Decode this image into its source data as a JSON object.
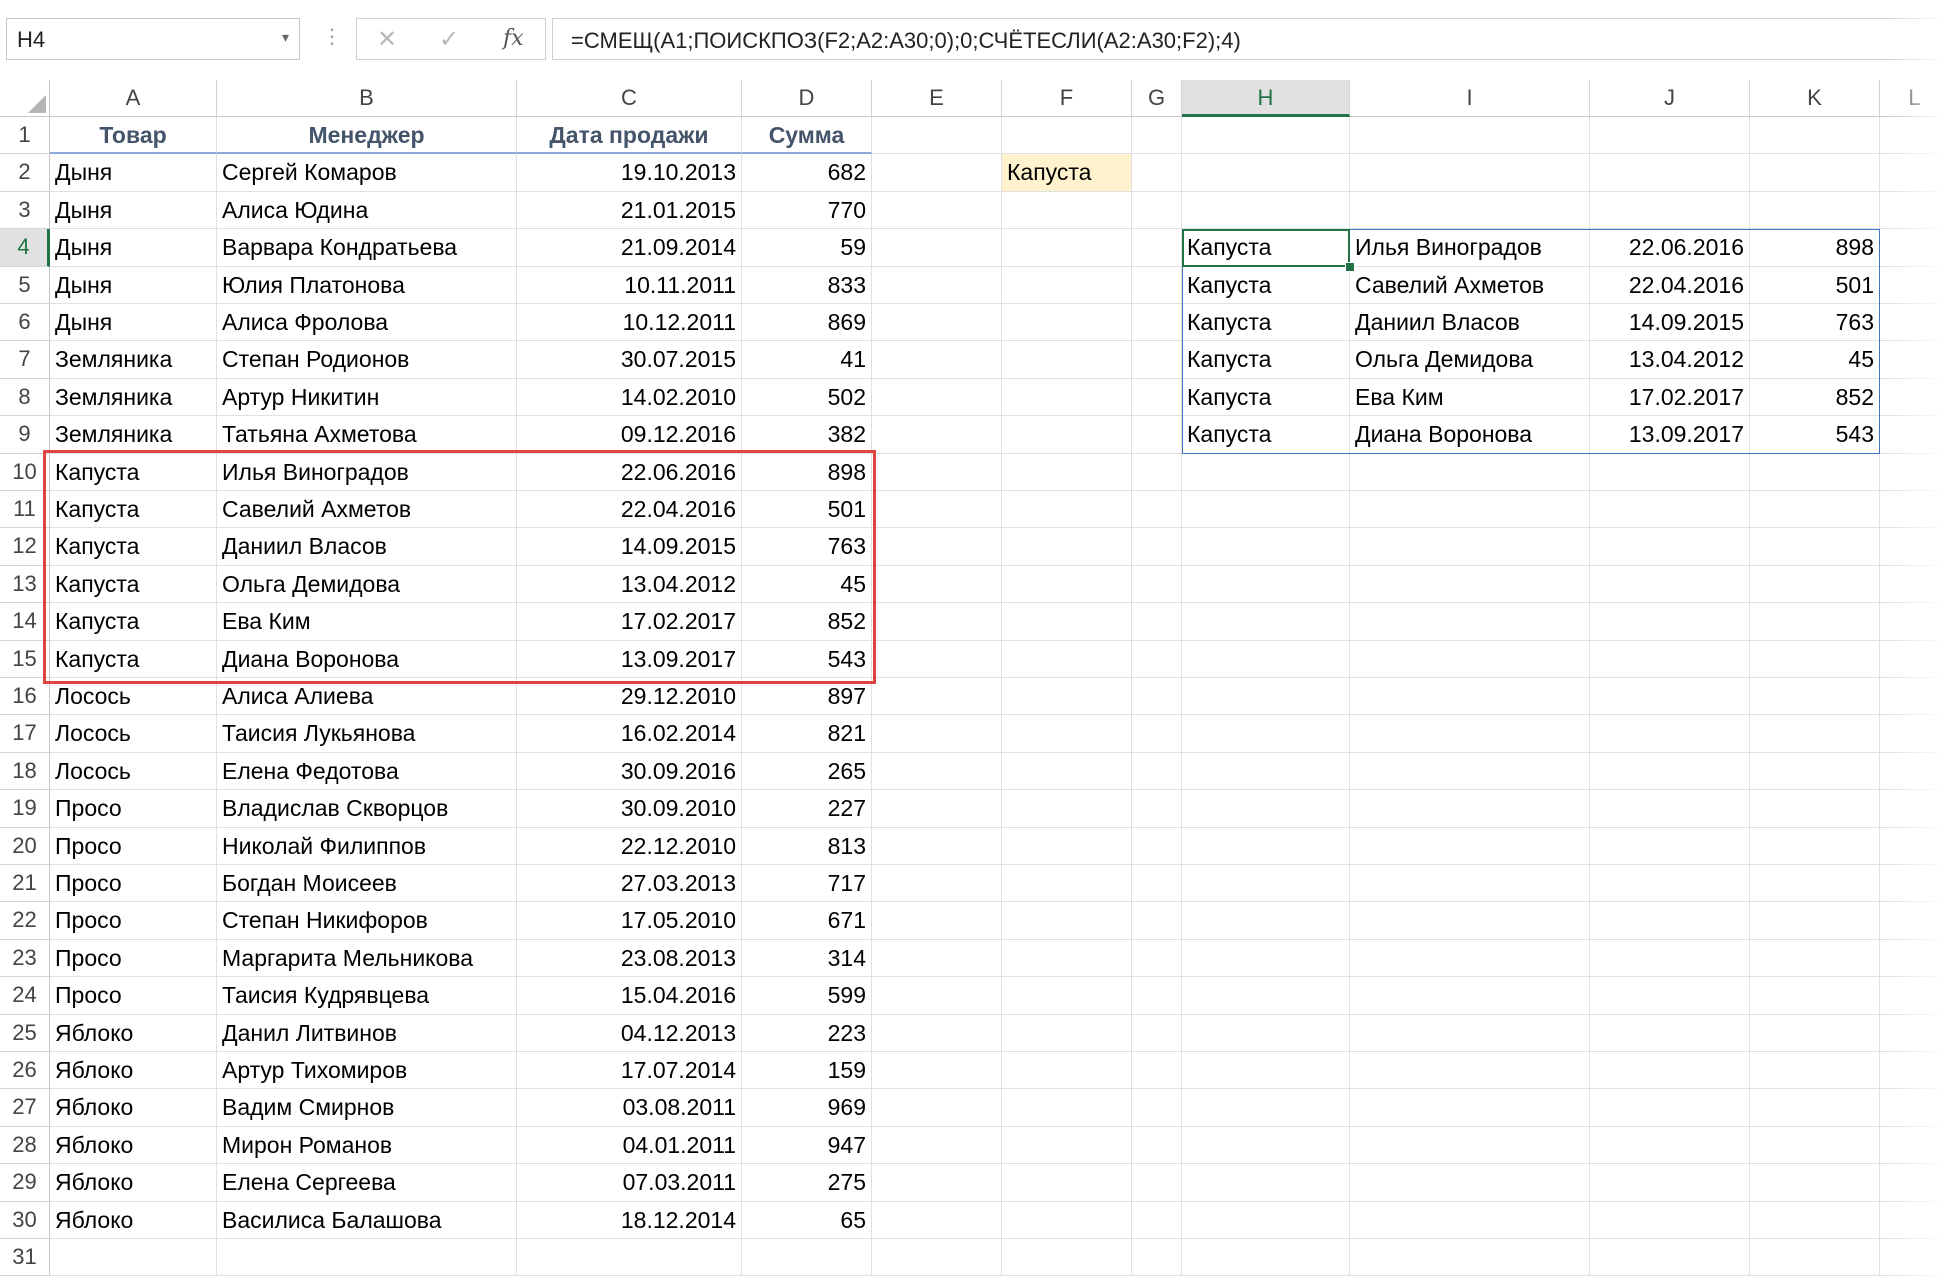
{
  "name_box": {
    "value": "H4"
  },
  "formula": {
    "text": "=СМЕЩ(A1;ПОИСКПОЗ(F2;A2:A30;0);0;СЧЁТЕСЛИ(A2:A30;F2);4)"
  },
  "columns": [
    "A",
    "B",
    "C",
    "D",
    "E",
    "F",
    "G",
    "H",
    "I",
    "J",
    "K",
    "L"
  ],
  "rows": [
    "1",
    "2",
    "3",
    "4",
    "5",
    "6",
    "7",
    "8",
    "9",
    "10",
    "11",
    "12",
    "13",
    "14",
    "15",
    "16",
    "17",
    "18",
    "19",
    "20",
    "21",
    "22",
    "23",
    "24",
    "25",
    "26",
    "27",
    "28",
    "29",
    "30",
    "31"
  ],
  "active_cell": {
    "column": "H",
    "row": "4"
  },
  "table": {
    "headers": [
      "Товар",
      "Менеджер",
      "Дата продажи",
      "Сумма"
    ],
    "rows": [
      [
        "Дыня",
        "Сергей Комаров",
        "19.10.2013",
        "682"
      ],
      [
        "Дыня",
        "Алиса Юдина",
        "21.01.2015",
        "770"
      ],
      [
        "Дыня",
        "Варвара Кондратьева",
        "21.09.2014",
        "59"
      ],
      [
        "Дыня",
        "Юлия Платонова",
        "10.11.2011",
        "833"
      ],
      [
        "Дыня",
        "Алиса Фролова",
        "10.12.2011",
        "869"
      ],
      [
        "Земляника",
        "Степан Родионов",
        "30.07.2015",
        "41"
      ],
      [
        "Земляника",
        "Артур Никитин",
        "14.02.2010",
        "502"
      ],
      [
        "Земляника",
        "Татьяна Ахметова",
        "09.12.2016",
        "382"
      ],
      [
        "Капуста",
        "Илья Виноградов",
        "22.06.2016",
        "898"
      ],
      [
        "Капуста",
        "Савелий Ахметов",
        "22.04.2016",
        "501"
      ],
      [
        "Капуста",
        "Даниил Власов",
        "14.09.2015",
        "763"
      ],
      [
        "Капуста",
        "Ольга Демидова",
        "13.04.2012",
        "45"
      ],
      [
        "Капуста",
        "Ева Ким",
        "17.02.2017",
        "852"
      ],
      [
        "Капуста",
        "Диана Воронова",
        "13.09.2017",
        "543"
      ],
      [
        "Лосось",
        "Алиса Алиева",
        "29.12.2010",
        "897"
      ],
      [
        "Лосось",
        "Таисия Лукьянова",
        "16.02.2014",
        "821"
      ],
      [
        "Лосось",
        "Елена Федотова",
        "30.09.2016",
        "265"
      ],
      [
        "Просо",
        "Владислав Скворцов",
        "30.09.2010",
        "227"
      ],
      [
        "Просо",
        "Николай Филиппов",
        "22.12.2010",
        "813"
      ],
      [
        "Просо",
        "Богдан Моисеев",
        "27.03.2013",
        "717"
      ],
      [
        "Просо",
        "Степан Никифоров",
        "17.05.2010",
        "671"
      ],
      [
        "Просо",
        "Маргарита Мельникова",
        "23.08.2013",
        "314"
      ],
      [
        "Просо",
        "Таисия Кудрявцева",
        "15.04.2016",
        "599"
      ],
      [
        "Яблоко",
        "Данил Литвинов",
        "04.12.2013",
        "223"
      ],
      [
        "Яблоко",
        "Артур Тихомиров",
        "17.07.2014",
        "159"
      ],
      [
        "Яблоко",
        "Вадим Смирнов",
        "03.08.2011",
        "969"
      ],
      [
        "Яблоко",
        "Мирон Романов",
        "04.01.2011",
        "947"
      ],
      [
        "Яблоко",
        "Елена Сергеева",
        "07.03.2011",
        "275"
      ],
      [
        "Яблоко",
        "Василиса Балашова",
        "18.12.2014",
        "65"
      ]
    ]
  },
  "criteria": {
    "f2": "Капуста"
  },
  "result": {
    "rows": [
      [
        "Капуста",
        "Илья Виноградов",
        "22.06.2016",
        "898"
      ],
      [
        "Капуста",
        "Савелий Ахметов",
        "22.04.2016",
        "501"
      ],
      [
        "Капуста",
        "Даниил Власов",
        "14.09.2015",
        "763"
      ],
      [
        "Капуста",
        "Ольга Демидова",
        "13.04.2012",
        "45"
      ],
      [
        "Капуста",
        "Ева Ким",
        "17.02.2017",
        "852"
      ],
      [
        "Капуста",
        "Диана Воронова",
        "13.09.2017",
        "543"
      ]
    ]
  },
  "icons": {
    "name_box_arrow": "▾",
    "dots": "⋮",
    "cancel": "✕",
    "enter": "✓",
    "fx": "fx"
  },
  "colors": {
    "accent": "#217346",
    "highlight": "#e0443e",
    "spill": "#4472c4",
    "criteria_fill": "#fff2cc",
    "header_text": "#44546a"
  }
}
